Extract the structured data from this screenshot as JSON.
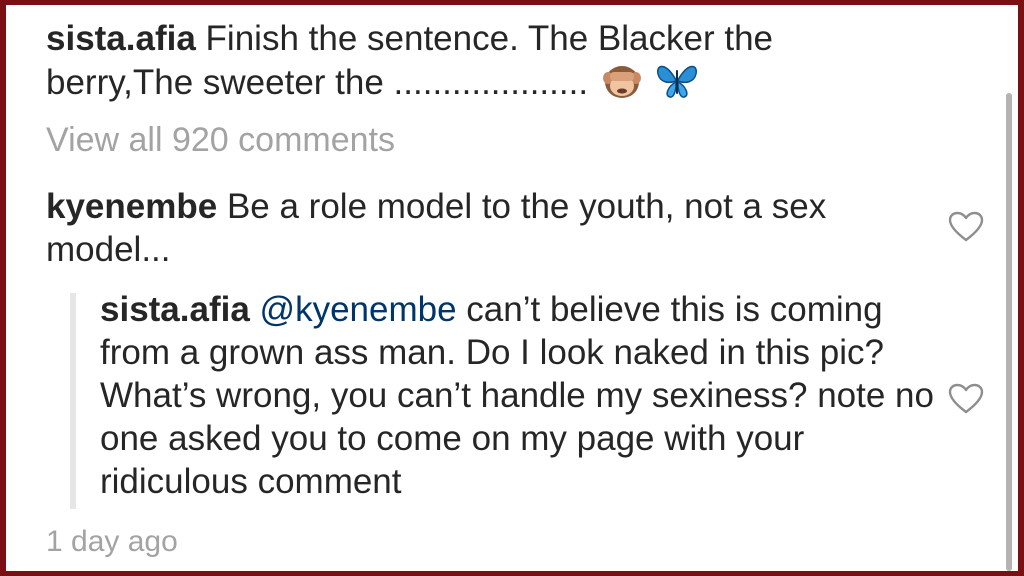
{
  "caption": {
    "username": "sista.afia",
    "text_line": "Finish the sentence. The Blacker the berry,The sweeter the ....................",
    "emoji": [
      "see-no-evil-monkey",
      "butterfly"
    ]
  },
  "view_all": "View all 920 comments",
  "comments": [
    {
      "username": "kyenembe",
      "text": "Be a role model to the youth, not a sex model...",
      "like_icon": "heart-outline-icon"
    }
  ],
  "reply": {
    "username": "sista.afia",
    "mention": "@kyenembe",
    "text": "can’t believe this is coming from a grown ass man. Do I look naked in this pic? What’s wrong, you can’t handle my sexiness? note no one asked you to come on my page with your ridiculous comment",
    "like_icon": "heart-outline-icon"
  },
  "timestamp": "1 day ago",
  "colors": {
    "border": "#7a0f14",
    "text": "#262626",
    "mention": "#003569",
    "muted": "#a3a3a3"
  }
}
